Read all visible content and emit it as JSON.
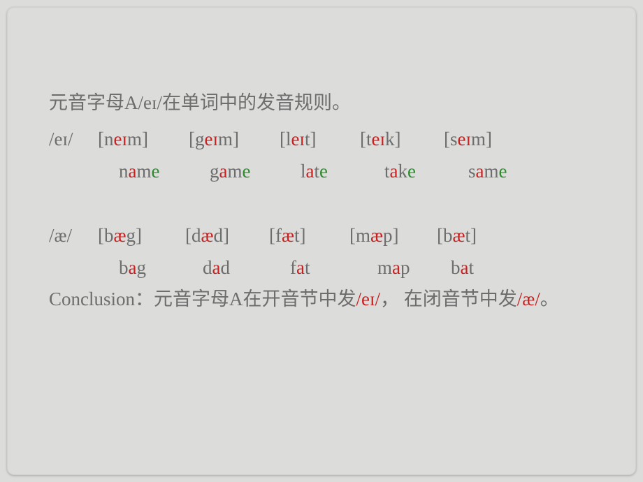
{
  "title": "元音字母A/eɪ/在单词中的发音规则。",
  "section1": {
    "label": "/eɪ/",
    "ipa": [
      {
        "open": "[n",
        "mid": "eɪ",
        "close": "m]"
      },
      {
        "open": "[g",
        "mid": "eɪ",
        "close": "m]"
      },
      {
        "open": "[l",
        "mid": "eɪ",
        "close": "t]"
      },
      {
        "open": "[t",
        "mid": "eɪ",
        "close": "k]"
      },
      {
        "open": "[s",
        "mid": "eɪ",
        "close": "m]"
      }
    ],
    "words": [
      {
        "pre": "n",
        "vowel": "a",
        "mid": "m",
        "end": "e"
      },
      {
        "pre": "g",
        "vowel": "a",
        "mid": "m",
        "end": "e"
      },
      {
        "pre": "l",
        "vowel": "a",
        "mid": "t",
        "end": "e"
      },
      {
        "pre": "t",
        "vowel": "a",
        "mid": "k",
        "end": "e"
      },
      {
        "pre": "s",
        "vowel": "a",
        "mid": "m",
        "end": "e"
      }
    ]
  },
  "section2": {
    "label": "/æ/",
    "ipa": [
      {
        "open": "[b",
        "mid": "æ",
        "close": "g]"
      },
      {
        "open": "[d",
        "mid": "æ",
        "close": "d]"
      },
      {
        "open": "[f",
        "mid": "æ",
        "close": "t]"
      },
      {
        "open": "[m",
        "mid": "æ",
        "close": "p]"
      },
      {
        "open": "[b",
        "mid": "æ",
        "close": "t]"
      }
    ],
    "words": [
      {
        "pre": "b",
        "vowel": "a",
        "post": "g"
      },
      {
        "pre": "d",
        "vowel": "a",
        "post": "d"
      },
      {
        "pre": "f",
        "vowel": "a",
        "post": "t"
      },
      {
        "pre": "m",
        "vowel": "a",
        "post": "p"
      },
      {
        "pre": "b",
        "vowel": "a",
        "post": "t"
      }
    ]
  },
  "conclusion": {
    "prefix": "Conclusion：元音字母A在开音节中发",
    "p1": "/eɪ/",
    "mid": "， 在闭音节中发",
    "p2": "/æ/",
    "suffix": "。"
  }
}
